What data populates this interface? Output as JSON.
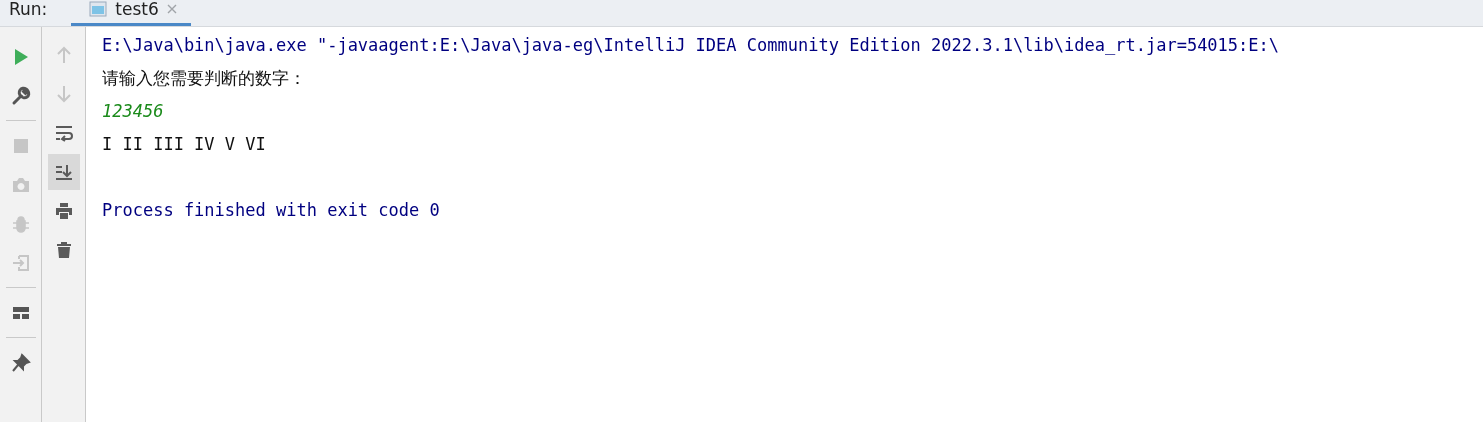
{
  "tool_window": {
    "title": "Run:"
  },
  "tabs": [
    {
      "label": "test6",
      "selected": true
    }
  ],
  "left_toolbar": [
    {
      "disabled": false
    },
    {
      "disabled": false
    },
    {
      "disabled": true
    },
    {
      "disabled": true
    },
    {
      "disabled": true
    },
    {
      "disabled": true
    },
    {
      "disabled": false
    },
    {
      "disabled": false
    }
  ],
  "output_toolbar": [
    {
      "disabled": true,
      "selected": false
    },
    {
      "disabled": true,
      "selected": false
    },
    {
      "disabled": false,
      "selected": false
    },
    {
      "disabled": false,
      "selected": true
    },
    {
      "disabled": false,
      "selected": false
    },
    {
      "disabled": false,
      "selected": false
    }
  ],
  "console_lines": [
    {
      "kind": "system",
      "text": "E:\\Java\\bin\\java.exe \"-javaagent:E:\\Java\\java-eg\\IntelliJ IDEA Community Edition 2022.3.1\\lib\\idea_rt.jar=54015:E:\\"
    },
    {
      "kind": "stdout",
      "text": "请输入您需要判断的数字："
    },
    {
      "kind": "input",
      "text": "123456"
    },
    {
      "kind": "stdout",
      "text": "I II III IV V VI"
    },
    {
      "kind": "blank"
    },
    {
      "kind": "system",
      "text": "Process finished with exit code 0"
    }
  ]
}
